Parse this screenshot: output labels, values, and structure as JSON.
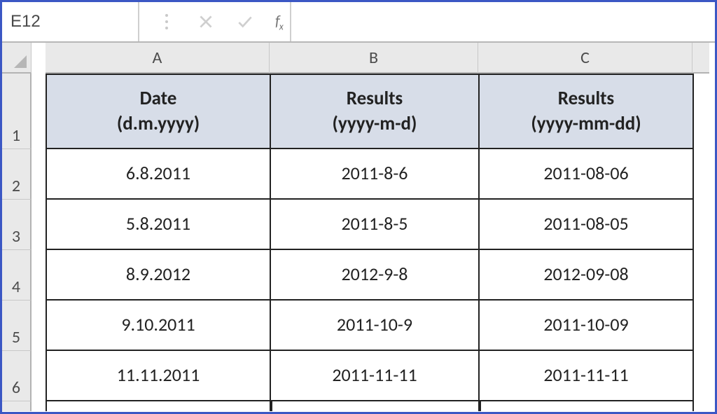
{
  "nameBox": "E12",
  "formula": "",
  "columns": [
    "A",
    "B",
    "C"
  ],
  "headers": {
    "a": "Date\n(d.m.yyyy)",
    "b": "Results\n(yyyy-m-d)",
    "c": "Results\n(yyyy-mm-dd)"
  },
  "rows": [
    {
      "n": "2",
      "a": "6.8.2011",
      "b": "2011-8-6",
      "c": "2011-08-06"
    },
    {
      "n": "3",
      "a": "5.8.2011",
      "b": "2011-8-5",
      "c": "2011-08-05"
    },
    {
      "n": "4",
      "a": "8.9.2012",
      "b": "2012-9-8",
      "c": "2012-09-08"
    },
    {
      "n": "5",
      "a": "9.10.2011",
      "b": "2011-10-9",
      "c": "2011-10-09"
    },
    {
      "n": "6",
      "a": "11.11.2011",
      "b": "2011-11-11",
      "c": "2011-11-11"
    }
  ],
  "headerRowNumber": "1"
}
